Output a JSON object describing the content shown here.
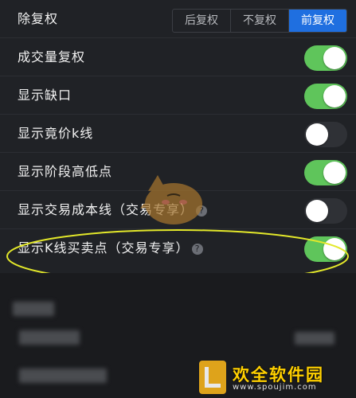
{
  "restoration": {
    "label": "除复权",
    "options": [
      "后复权",
      "不复权",
      "前复权"
    ],
    "selected_index": 2,
    "accent_color": "#1f6fe0"
  },
  "settings": [
    {
      "label": "成交量复权",
      "on": true,
      "help": false
    },
    {
      "label": "显示缺口",
      "on": true,
      "help": false
    },
    {
      "label": "显示竟价k线",
      "on": false,
      "help": false
    },
    {
      "label": "显示阶段高低点",
      "on": true,
      "help": false
    },
    {
      "label": "显示交易成本线（交易专享）",
      "on": false,
      "help": true
    },
    {
      "label": "显示K线买卖点（交易专享）",
      "on": true,
      "help": true
    }
  ],
  "help_glyph": "?",
  "toggle_on_color": "#5fc55b",
  "highlight_color": "#e3e82a",
  "watermark": {
    "title": "欢全软件园",
    "subtitle": "www.spoujim.com"
  }
}
